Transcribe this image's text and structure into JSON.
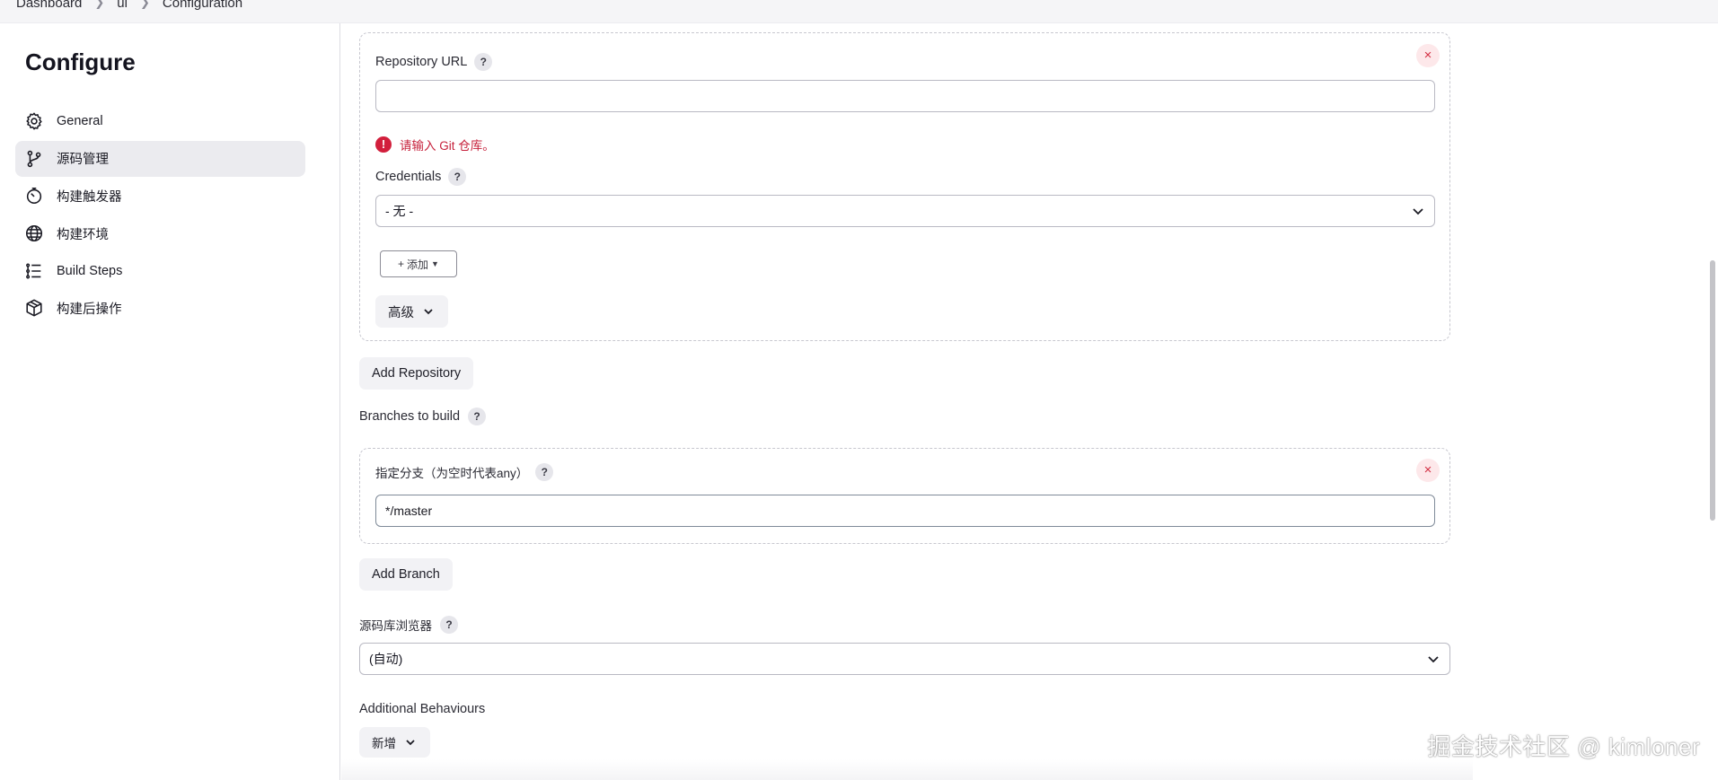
{
  "breadcrumb": {
    "items": [
      "Dashboard",
      "ui",
      "Configuration"
    ]
  },
  "sidebar": {
    "title": "Configure",
    "items": [
      {
        "label": "General",
        "icon": "gear-icon",
        "active": false
      },
      {
        "label": "源码管理",
        "icon": "git-branch-icon",
        "active": true
      },
      {
        "label": "构建触发器",
        "icon": "timer-icon",
        "active": false
      },
      {
        "label": "构建环境",
        "icon": "globe-icon",
        "active": false
      },
      {
        "label": "Build Steps",
        "icon": "list-icon",
        "active": false
      },
      {
        "label": "构建后操作",
        "icon": "package-icon",
        "active": false
      }
    ]
  },
  "repository": {
    "url_label": "Repository URL",
    "url_value": "",
    "error": "请输入 Git 仓库。",
    "credentials_label": "Credentials",
    "credentials_value": "- 无 -",
    "add_cred_label": "添加",
    "advanced_label": "高级",
    "add_repository_label": "Add Repository"
  },
  "branches": {
    "section_label": "Branches to build",
    "spec_label": "指定分支（为空时代表any）",
    "spec_value": "*/master",
    "add_branch_label": "Add Branch"
  },
  "browser": {
    "label": "源码库浏览器",
    "value": "(自动)"
  },
  "behaviours": {
    "label": "Additional Behaviours",
    "add_label": "新增"
  },
  "help_glyph": "?",
  "close_glyph": "×",
  "error_glyph": "!",
  "watermark": "掘金技术社区 @ kimloner",
  "colors": {
    "error": "#c61f3a",
    "active_nav": "#ebebef",
    "close_bg": "#fde8ea"
  }
}
